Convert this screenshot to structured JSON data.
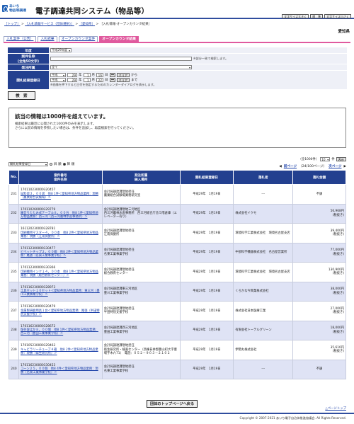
{
  "header": {
    "logo_text": "あいち電子調達共同システム",
    "logo_line1": "あいち",
    "logo_line2": "物品等調達",
    "title": "電子調達共同システム（物品等）",
    "buttons": [
      "文字サイズ大きく",
      "標　準",
      "文字サイズ小さく"
    ]
  },
  "breadcrumb": {
    "items": [
      "［トップ］",
      "［入札情報サービス（団体選択）］",
      "［愛知県］"
    ],
    "current": "［入札情報-オープンカウンタ結果］",
    "sep": ">"
  },
  "region": "愛知県",
  "tabs": [
    {
      "label": "入札案件（公告）",
      "active": false
    },
    {
      "label": "入札結果",
      "active": false
    },
    {
      "label": "オープンカウンタ案件",
      "active": false
    },
    {
      "label": "オープンカウンタ結果",
      "active": true
    }
  ],
  "search": {
    "year_label": "年度",
    "year_value": "平成29年度",
    "case_label": "案件名称",
    "case_label_sub": "(全角50文字)",
    "case_value": "",
    "case_note": "※部分一致で検索します。",
    "org_label": "発注所属",
    "org_value": "全て",
    "date_label": "開札結果登録日",
    "from_era": "平成",
    "from_year": "29",
    "from_month": "1",
    "from_day": "16",
    "to_era": "平成",
    "to_year": "29",
    "to_month": "1",
    "to_day": "22",
    "year_unit": "年",
    "month_unit": "月",
    "day_unit": "日",
    "clear_label": "クリア",
    "from_suffix": "から",
    "to_suffix": "まで",
    "date_note": "※画像を押下すると日付を指定するためのカレンダーダイアログを表示します。",
    "search_button": "検　索"
  },
  "message": {
    "title": "該当の情報は1000件を超えています。",
    "line1": "検索結果は最近に公開された1000件のみを表示します。",
    "line2": "さらに以前の情報を参照したい場合は、条件を追加し、再度検索を行ってください。"
  },
  "sort": {
    "field": "開札結果登録日",
    "asc_label": "昇 順",
    "desc_label": "降 順",
    "selected": "desc"
  },
  "pagination": {
    "total": "（全1000件）",
    "per_page": "10",
    "per_page_suffix": "件",
    "go_label": "表示",
    "prev": "前ページ",
    "status": "（24/100ページ）",
    "next": "次ページ"
  },
  "table": {
    "headers": {
      "no": "No.",
      "num_case": "案件番号\n案件名称",
      "org": "発注所属\n納入場所",
      "date": "開札結果登録日",
      "bidder": "落札者",
      "amount": "落札金額"
    },
    "rows": [
      {
        "no": "231",
        "number": "170110230000320457",
        "name": "試料袋３，００袋　他8 1件＜愛知県地方物品業務：現勝（農業総合試験場）＞",
        "org": "会計局調達課現地担任",
        "place": "農業総合試験場業務研究室",
        "date": "平成29年　1月19日",
        "bidder": "---",
        "amount": "不調",
        "tax": ""
      },
      {
        "no": "232",
        "number": "170110260000329779",
        "name": "園芸りたたみ式テーブル８，００台　他8 1件＜愛知県地方物品業務：西三河（西三河農林水産事務所）＞",
        "org": "会計局調達課現地三河地区",
        "place": "西三河農林水産事務所　西三河総合庁舎５階倉庫（エレベーター有り）",
        "date": "平成29年　1月19日",
        "bidder": "株式会社イクモ",
        "amount": "56,968円",
        "tax": "(税抜き)"
      },
      {
        "no": "233",
        "number": "161120230000328781",
        "name": "印刷機用マスター４，００本　他8 2件＜愛知県地方物品業務：現勝（江南保健所）＞",
        "org": "会計局調達課現地担任",
        "place": "江南保健所",
        "date": "平成29年　1月19日",
        "bidder": "環境科学工業株式会社　環境名古屋支店",
        "amount": "39,400円",
        "tax": "(税抜き)"
      },
      {
        "no": "234",
        "number": "170112300000330477",
        "name": "ビペットチップ２，００箱　他8 2件＜愛知県地方物品業務：尾張（名東工業事業学校）＞",
        "org": "会計局調達課現地担任",
        "place": "名東工業事業学校",
        "date": "平成29年　1月19日",
        "bidder": "中部科学機器株式会社　名古屋営業所",
        "amount": "77,000円",
        "tax": "(税抜き)"
      },
      {
        "no": "235",
        "number": "170112300000330366",
        "name": "印刷機用インク１４，００本　他8 1件＜愛知県地方物品業務：現勝（総合教育センター）＞",
        "org": "会計局調達課現地担任",
        "place": "総合教育センター",
        "date": "平成29年　1月19日",
        "bidder": "環境科学工業株式会社　環境名古屋支店",
        "amount": "130,900円",
        "tax": "(税抜き)"
      },
      {
        "no": "236",
        "number": "170116230000328973",
        "name": "工具セット１０セット＜愛知県地方物品業務：東三河（豊川工業事業学校）＞",
        "org": "会計局調達課東三河地区",
        "place": "豊川工業事業学校",
        "date": "平成29年　1月19日",
        "bidder": "くろかな今興業株式会社",
        "amount": "38,000円",
        "tax": "(税抜き)"
      },
      {
        "no": "237",
        "number": "170116230000320479",
        "name": "金属製研磨用具１台＜愛知県地方物品業務：尾張（半田特別支援学校）＞",
        "org": "会計局調達課現地担任",
        "place": "半田特別支援学校",
        "date": "平成29年　1月19日",
        "bidder": "株式会社日本医療工業",
        "amount": "27,000円",
        "tax": "(税抜き)"
      },
      {
        "no": "238",
        "number": "170116230000328672",
        "name": "保存容ほか８，００個　他8 1件＜愛知県地方物品業務：西三河（豊田工業事業学校）＞",
        "org": "会計局調達課西三河地区",
        "place": "豊田工業事業学校",
        "date": "平成29年　1月19日",
        "bidder": "有限会社トーテルグリーン",
        "amount": "18,000円",
        "tax": "(税抜き)"
      },
      {
        "no": "239",
        "number": "170105230000329463",
        "name": "キャビラリーチューブ４箱　他8 2件＜愛知県地方物品業務：現勝（衛生研究所）＞",
        "org": "会計局調達課現地担任",
        "place": "衛生研究所・検査センター（西棟日井郡豊山町大字豊場字木六71）　電話：０５２－９０３－２１０２",
        "date": "平成29年　1月19日",
        "bidder": "伊勢丸株式会社",
        "amount": "35,610円",
        "tax": "(税抜き)"
      },
      {
        "no": "240",
        "number": "170116230000330453",
        "name": "コーン２５，００個　他8 4件＜愛知県地方物品業務：現勝（名東工業事業学校）＞",
        "org": "会計局調達課現地担任",
        "place": "名東工業事業学校",
        "date": "平成29年　1月19日",
        "bidder": "---",
        "amount": "不調",
        "tax": ""
      }
    ]
  },
  "footer": {
    "top_button": "団体のトップページへ戻る",
    "page_top": "△ページトップ",
    "copyright": "Copyright © 2007-2021 あいち電子自治体推進協議会. All Rights Reserved."
  },
  "colors": {
    "navy": "#23408f",
    "pink": "#e05a9e",
    "row_alt": "#dfe3f5",
    "panel_bg": "#eef0f7"
  }
}
